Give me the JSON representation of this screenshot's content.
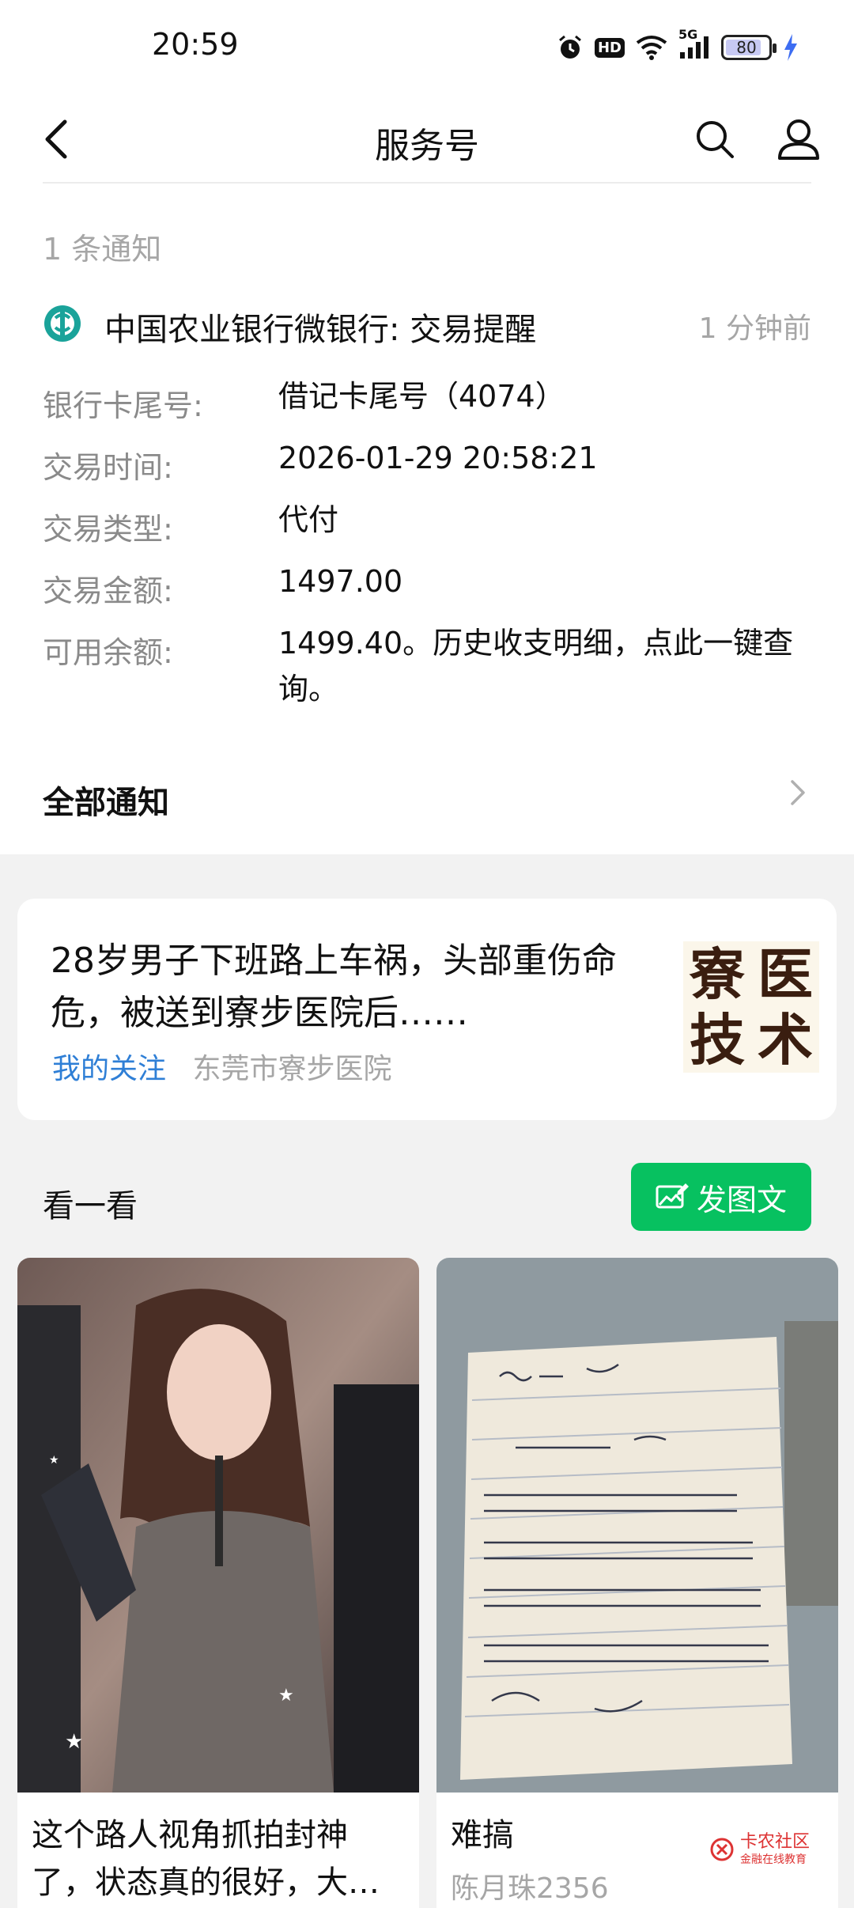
{
  "status_bar": {
    "time": "20:59",
    "network": "5G",
    "hd_label": "HD",
    "battery": "80"
  },
  "nav": {
    "title": "服务号"
  },
  "notice": {
    "count_text": "1 条通知",
    "sender": "中国农业银行微银行:  交易提醒",
    "time_ago": "1 分钟前",
    "fields": [
      {
        "label": "银行卡尾号:",
        "value": "借记卡尾号（4074）"
      },
      {
        "label": "交易时间:",
        "value": "2026-01-29 20:58:21"
      },
      {
        "label": "交易类型:",
        "value": "代付"
      },
      {
        "label": "交易金额:",
        "value": "1497.00"
      },
      {
        "label": "可用余额:",
        "value": "1499.40。历史收支明细，点此一键查询。"
      }
    ],
    "all_label": "全部通知"
  },
  "article": {
    "title": "28岁男子下班路上车祸，头部重伤命危，被送到寮步医院后……",
    "tag": "我的关注",
    "source": "东莞市寮步医院",
    "thumb_chars": [
      "寮",
      "医",
      "技",
      "术"
    ]
  },
  "look": {
    "title": "看一看",
    "post_button": "发图文"
  },
  "feed": [
    {
      "title": "这个路人视角抓拍封神了，状态真的很好，大…",
      "author": ""
    },
    {
      "title": "难搞",
      "author": "陈月珠2356"
    }
  ],
  "watermark": {
    "name": "卡农社区",
    "sub": "金融在线教育"
  },
  "colors": {
    "accent_green": "#07c160",
    "link_blue": "#2f7fd6",
    "bank_teal": "#1aa39a"
  }
}
